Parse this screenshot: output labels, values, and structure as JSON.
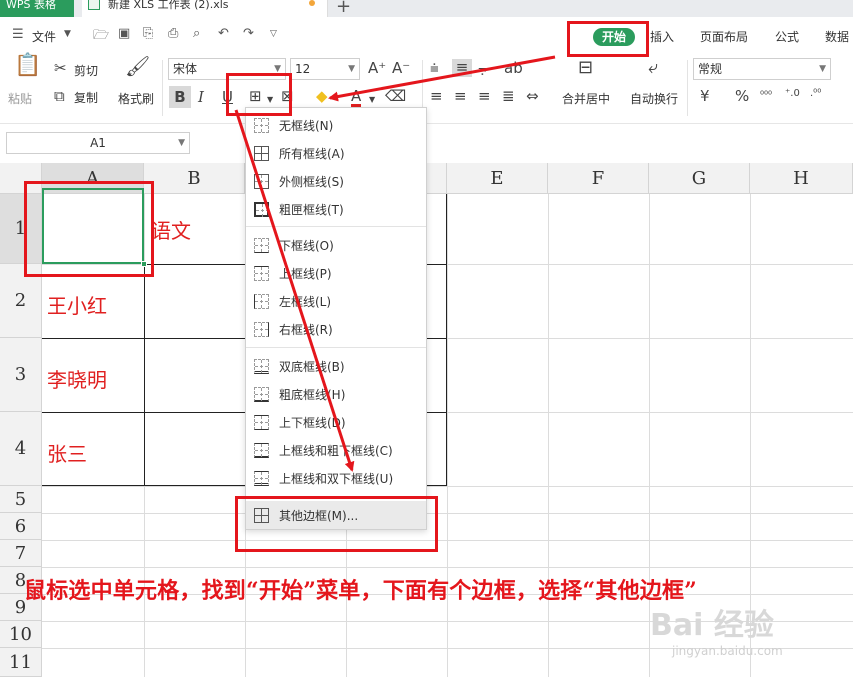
{
  "titlebar": {
    "app_tab": "WPS 表格",
    "doc_tab": "新建 XLS 工作表 (2).xls",
    "new_tab": "+"
  },
  "menubar": {
    "file_label": "文件",
    "tabs": [
      "开始",
      "插入",
      "页面布局",
      "公式",
      "数据"
    ]
  },
  "ribbon": {
    "paste_label": "粘贴",
    "cut_label": "剪切",
    "copy_label": "复制",
    "format_painter_label": "格式刷",
    "font_name": "宋体",
    "font_size": "12",
    "merge_center_label": "合并居中",
    "wrap_text_label": "自动换行",
    "number_format": "常规",
    "currency_symbol": "¥",
    "percent_symbol": "%"
  },
  "formula_bar": {
    "name_box": "A1"
  },
  "sheet": {
    "columns": [
      "A",
      "B",
      "C",
      "D",
      "E",
      "F",
      "G",
      "H"
    ],
    "rows": [
      "1",
      "2",
      "3",
      "4",
      "5",
      "6",
      "7",
      "8",
      "9",
      "10",
      "11"
    ],
    "cells": {
      "B1": "语文",
      "A2": "王小红",
      "A3": "李晓明",
      "A4": "张三"
    }
  },
  "border_menu": {
    "items": [
      "无框线(N)",
      "所有框线(A)",
      "外侧框线(S)",
      "粗匣框线(T)",
      "下框线(O)",
      "上框线(P)",
      "左框线(L)",
      "右框线(R)",
      "双底框线(B)",
      "粗底框线(H)",
      "上下框线(D)",
      "上框线和粗下框线(C)",
      "上框线和双下框线(U)",
      "其他边框(M)..."
    ]
  },
  "annotation": {
    "instruction": "鼠标选中单元格，找到“开始”菜单，下面有个边框，选择“其他边框”",
    "color": "#e4161c"
  },
  "watermark": {
    "main": "Bai 经验",
    "sub": "jingyan.baidu.com"
  },
  "colors": {
    "accent": "#2b9c5d",
    "cell_text": "#e02020"
  }
}
